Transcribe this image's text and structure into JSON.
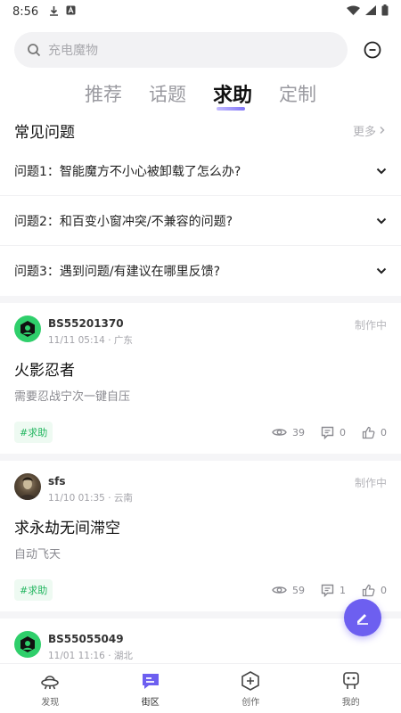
{
  "status_bar": {
    "time": "8:56"
  },
  "search": {
    "placeholder": "充电魔物"
  },
  "tabs": [
    {
      "label": "推荐",
      "active": false
    },
    {
      "label": "话题",
      "active": false
    },
    {
      "label": "求助",
      "active": true
    },
    {
      "label": "定制",
      "active": false
    }
  ],
  "faq": {
    "title": "常见问题",
    "more_label": "更多",
    "items": [
      "问题1：智能魔方不小心被卸载了怎么办?",
      "问题2：和百变小窗冲突/不兼容的问题?",
      "问题3：遇到问题/有建议在哪里反馈?"
    ]
  },
  "posts": [
    {
      "author": "BS55201370",
      "meta": "11/11 05:14 · 广东",
      "status": "制作中",
      "title": "火影忍者",
      "desc": "需要忍战宁次一键自压",
      "tag": "#求助",
      "views": "39",
      "comments": "0",
      "likes": "0"
    },
    {
      "author": "sfs",
      "meta": "11/10 01:35 · 云南",
      "status": "制作中",
      "title": "求永劫无间滞空",
      "desc": "自动飞天",
      "tag": "#求助",
      "views": "59",
      "comments": "1",
      "likes": "0"
    },
    {
      "author": "BS55055049",
      "meta": "11/01 11:16 · 湖北"
    }
  ],
  "bottom_nav": [
    {
      "label": "发现",
      "icon": "ufo-icon"
    },
    {
      "label": "街区",
      "icon": "chat-icon",
      "active": true
    },
    {
      "label": "创作",
      "icon": "add-icon"
    },
    {
      "label": "我的",
      "icon": "robot-icon"
    }
  ],
  "colors": {
    "accent": "#6d5ff0",
    "tag_green": "#22b55f",
    "avatar_green": "#2fcf6b"
  }
}
